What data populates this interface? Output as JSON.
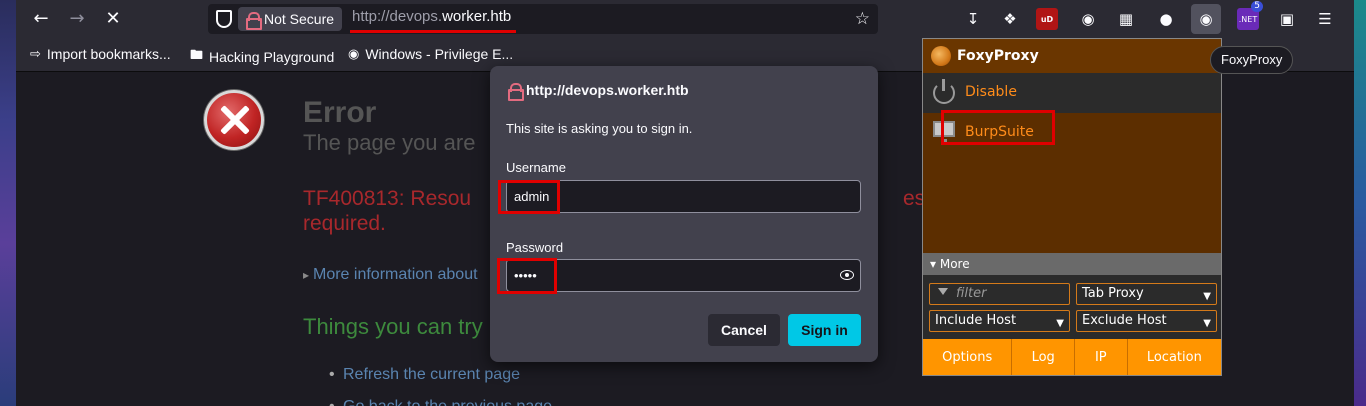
{
  "browser": {
    "url_prefix": "http://devops.",
    "url_host": "worker.htb",
    "not_secure_label": "Not Secure"
  },
  "bookmarks": [
    {
      "label": "Import bookmarks..."
    },
    {
      "label": "Hacking Playground"
    },
    {
      "label": "Windows - Privilege E..."
    }
  ],
  "page": {
    "error_title": "Error",
    "error_subtitle": "The page you are",
    "error_code_line1": "TF400813: Resou",
    "error_code_tail": "ess.",
    "error_code_line2": "required.",
    "more_info": "More information about",
    "things_heading": "Things you can try",
    "actions": [
      "Refresh the current page",
      "Go back to the previous page"
    ]
  },
  "auth_dialog": {
    "origin": "http://devops.worker.htb",
    "message": "This site is asking you to sign in.",
    "username_label": "Username",
    "username_value": "admin",
    "password_label": "Password",
    "password_value": "•••••",
    "cancel_label": "Cancel",
    "signin_label": "Sign in"
  },
  "foxyproxy": {
    "title": "FoxyProxy",
    "disable_label": "Disable",
    "proxy_label": "BurpSuite",
    "more_label": "▾ More",
    "filter_placeholder": "filter",
    "tab_proxy": "Tab Proxy",
    "include_host": "Include Host",
    "exclude_host": "Exclude Host",
    "tabs": [
      "Options",
      "Log",
      "IP",
      "Location"
    ],
    "tooltip": "FoxyProxy"
  },
  "ext_badge_count": "5",
  "colors": {
    "accent_button": "#00c8e6",
    "highlight_red": "#e00000",
    "foxy_orange": "#ff9500"
  }
}
